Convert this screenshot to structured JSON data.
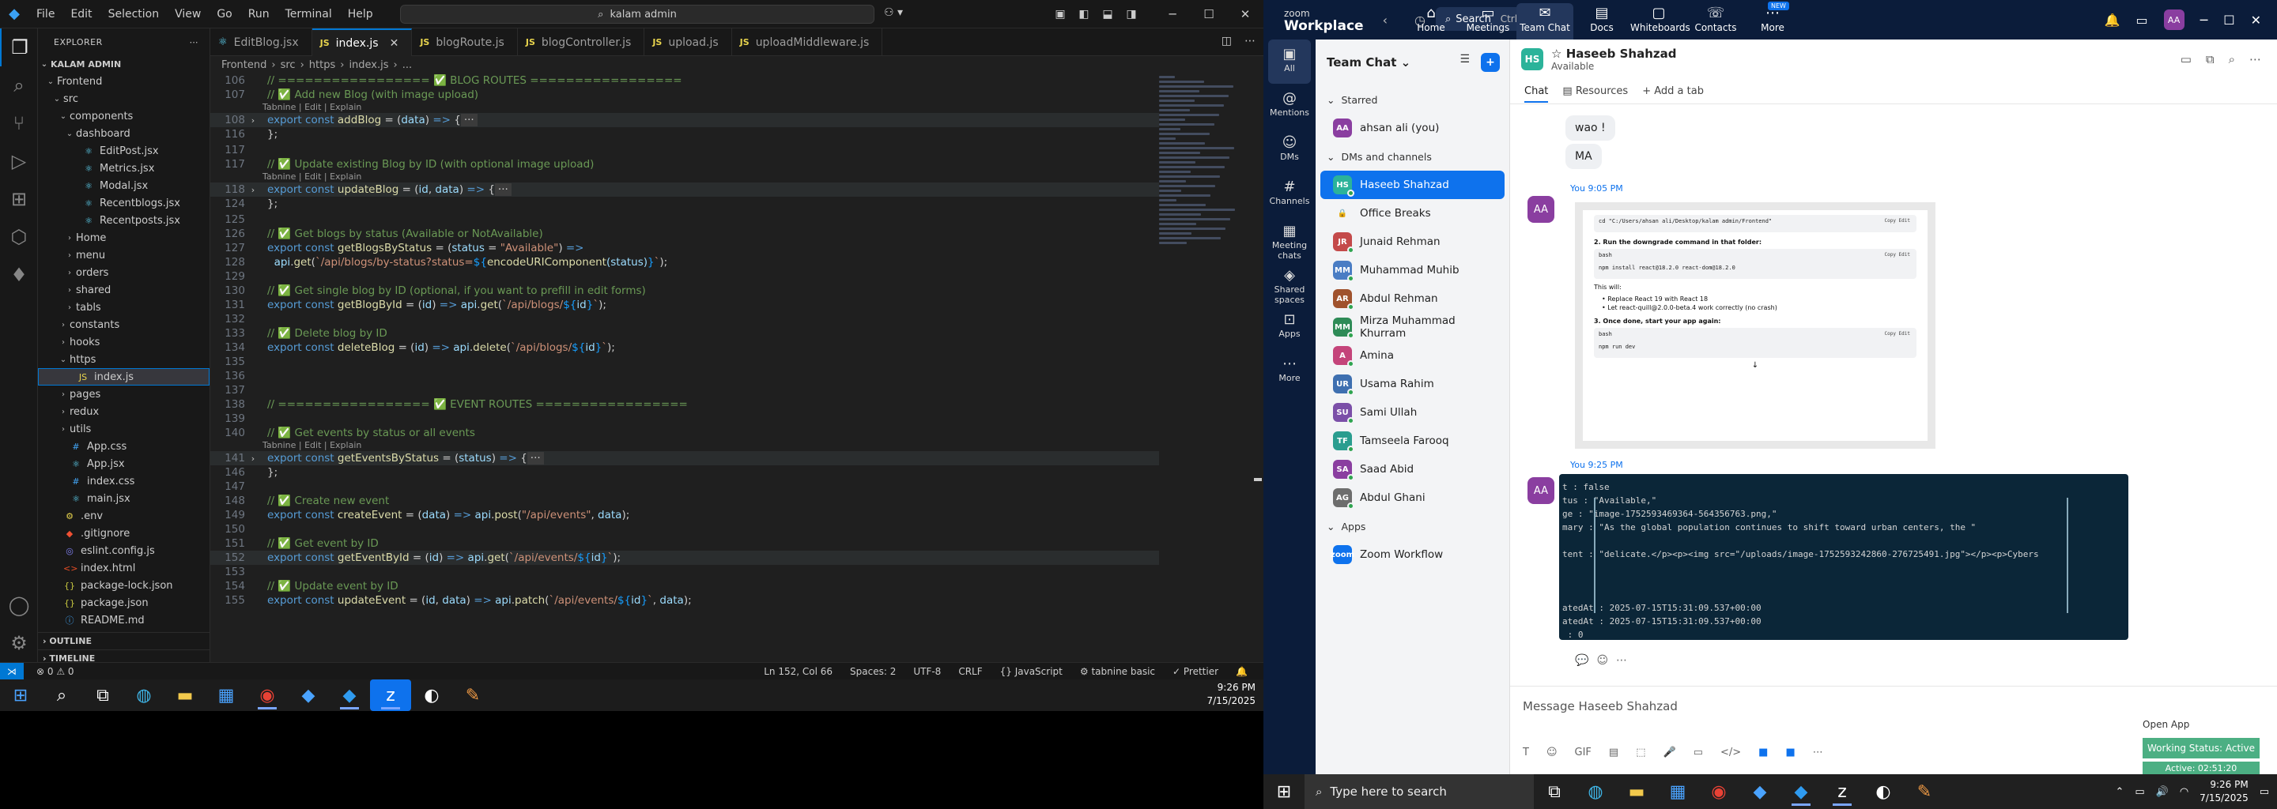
{
  "vscode": {
    "menu": [
      "File",
      "Edit",
      "Selection",
      "View",
      "Go",
      "Run",
      "Terminal",
      "Help"
    ],
    "command_center": "kalam admin",
    "explorer_title": "EXPLORER",
    "root": "KALAM ADMIN",
    "tree": [
      {
        "label": "Frontend",
        "depth": 1,
        "type": "folder",
        "open": true
      },
      {
        "label": "src",
        "depth": 2,
        "type": "folder",
        "open": true
      },
      {
        "label": "components",
        "depth": 3,
        "type": "folder",
        "open": true
      },
      {
        "label": "dashboard",
        "depth": 4,
        "type": "folder",
        "open": true
      },
      {
        "label": "EditPost.jsx",
        "depth": 5,
        "type": "jsx"
      },
      {
        "label": "Metrics.jsx",
        "depth": 5,
        "type": "jsx"
      },
      {
        "label": "Modal.jsx",
        "depth": 5,
        "type": "jsx"
      },
      {
        "label": "Recentblogs.jsx",
        "depth": 5,
        "type": "jsx"
      },
      {
        "label": "Recentposts.jsx",
        "depth": 5,
        "type": "jsx"
      },
      {
        "label": "Home",
        "depth": 4,
        "type": "folder"
      },
      {
        "label": "menu",
        "depth": 4,
        "type": "folder"
      },
      {
        "label": "orders",
        "depth": 4,
        "type": "folder"
      },
      {
        "label": "shared",
        "depth": 4,
        "type": "folder"
      },
      {
        "label": "tabls",
        "depth": 4,
        "type": "folder"
      },
      {
        "label": "constants",
        "depth": 3,
        "type": "folder"
      },
      {
        "label": "hooks",
        "depth": 3,
        "type": "folder"
      },
      {
        "label": "https",
        "depth": 3,
        "type": "folder",
        "open": true
      },
      {
        "label": "index.js",
        "depth": 4,
        "type": "js",
        "selected": true
      },
      {
        "label": "pages",
        "depth": 3,
        "type": "folder"
      },
      {
        "label": "redux",
        "depth": 3,
        "type": "folder"
      },
      {
        "label": "utils",
        "depth": 3,
        "type": "folder"
      },
      {
        "label": "App.css",
        "depth": 3,
        "type": "css"
      },
      {
        "label": "App.jsx",
        "depth": 3,
        "type": "jsx"
      },
      {
        "label": "index.css",
        "depth": 3,
        "type": "css"
      },
      {
        "label": "main.jsx",
        "depth": 3,
        "type": "jsx"
      },
      {
        "label": ".env",
        "depth": 2,
        "type": "env"
      },
      {
        "label": ".gitignore",
        "depth": 2,
        "type": "git"
      },
      {
        "label": "eslint.config.js",
        "depth": 2,
        "type": "eslint"
      },
      {
        "label": "index.html",
        "depth": 2,
        "type": "html"
      },
      {
        "label": "package-lock.json",
        "depth": 2,
        "type": "json"
      },
      {
        "label": "package.json",
        "depth": 2,
        "type": "json"
      },
      {
        "label": "README.md",
        "depth": 2,
        "type": "md"
      }
    ],
    "outline_label": "OUTLINE",
    "timeline_label": "TIMELINE",
    "tabs": [
      {
        "label": "EditBlog.jsx",
        "icon": "react"
      },
      {
        "label": "index.js",
        "icon": "js",
        "active": true
      },
      {
        "label": "blogRoute.js",
        "icon": "js"
      },
      {
        "label": "blogController.js",
        "icon": "js"
      },
      {
        "label": "upload.js",
        "icon": "js"
      },
      {
        "label": "uploadMiddleware.js",
        "icon": "js"
      }
    ],
    "breadcrumb": [
      "Frontend",
      "src",
      "https",
      "index.js",
      "..."
    ],
    "lens": "Tabnine | Edit | Explain",
    "status": {
      "errors": "⊗ 0 ⚠ 0",
      "position": "Ln 152, Col 66",
      "spaces": "Spaces: 2",
      "encoding": "UTF-8",
      "eol": "CRLF",
      "language": "{} JavaScript",
      "tabnine": "⚙ tabnine basic",
      "prettier": "✓ Prettier"
    }
  },
  "code_lines": [
    {
      "n": "106",
      "t": "// ================= ✅ BLOG ROUTES =================",
      "cls": "c"
    },
    {
      "n": "107",
      "t": "// ✅ Add new Blog (with image upload)",
      "cls": "c"
    },
    {
      "n": "108",
      "t": "export const addBlog = (data) => {···",
      "fold": true,
      "hl": true
    },
    {
      "n": "116",
      "t": "};"
    },
    {
      "n": "117",
      "t": ""
    },
    {
      "n": "117",
      "t": "// ✅ Update existing Blog by ID (with optional image upload)",
      "cls": "c"
    },
    {
      "n": "118",
      "t": "export const updateBlog = (id, data) => {···",
      "fold": true,
      "hl": true
    },
    {
      "n": "124",
      "t": "};"
    },
    {
      "n": "125",
      "t": ""
    },
    {
      "n": "126",
      "t": "// ✅ Get blogs by status (Available or NotAvailable)",
      "cls": "c"
    },
    {
      "n": "127",
      "t": "export const getBlogsByStatus = (status = \"Available\") =>"
    },
    {
      "n": "128",
      "t": "  api.get(`/api/blogs/by-status?status=${encodeURIComponent(status)}`);"
    },
    {
      "n": "129",
      "t": ""
    },
    {
      "n": "130",
      "t": "// ✅ Get single blog by ID (optional, if you want to prefill in edit forms)",
      "cls": "c"
    },
    {
      "n": "131",
      "t": "export const getBlogById = (id) => api.get(`/api/blogs/${id}`);"
    },
    {
      "n": "132",
      "t": ""
    },
    {
      "n": "133",
      "t": "// ✅ Delete blog by ID",
      "cls": "c"
    },
    {
      "n": "134",
      "t": "export const deleteBlog = (id) => api.delete(`/api/blogs/${id}`);"
    },
    {
      "n": "135",
      "t": ""
    },
    {
      "n": "136",
      "t": ""
    },
    {
      "n": "137",
      "t": ""
    },
    {
      "n": "138",
      "t": "// ================= ✅ EVENT ROUTES =================",
      "cls": "c"
    },
    {
      "n": "139",
      "t": ""
    },
    {
      "n": "140",
      "t": "// ✅ Get events by status or all events",
      "cls": "c"
    },
    {
      "n": "141",
      "t": "export const getEventsByStatus = (status) => {···",
      "fold": true,
      "hl": true
    },
    {
      "n": "146",
      "t": "};"
    },
    {
      "n": "147",
      "t": ""
    },
    {
      "n": "148",
      "t": "// ✅ Create new event",
      "cls": "c"
    },
    {
      "n": "149",
      "t": "export const createEvent = (data) => api.post(\"/api/events\", data);"
    },
    {
      "n": "150",
      "t": ""
    },
    {
      "n": "151",
      "t": "// ✅ Get event by ID",
      "cls": "c"
    },
    {
      "n": "152",
      "t": "export const getEventById = (id) => api.get(`/api/events/${id}`);",
      "hl": true
    },
    {
      "n": "153",
      "t": ""
    },
    {
      "n": "154",
      "t": "// ✅ Update event by ID",
      "cls": "c"
    },
    {
      "n": "155",
      "t": "export const updateEvent = (id, data) => api.patch(`/api/events/${id}`, data);"
    }
  ],
  "taskbar_left": {
    "time": "9:26 PM",
    "date": "7/15/2025"
  },
  "zoom": {
    "brand_top": "zoom",
    "brand": "Workplace",
    "search": "Search",
    "search_kb": "Ctrl+F",
    "tabs": [
      {
        "label": "Home",
        "icon": "⌂"
      },
      {
        "label": "Meetings",
        "icon": "▭"
      },
      {
        "label": "Team Chat",
        "icon": "✉",
        "active": true
      },
      {
        "label": "Docs",
        "icon": "▤"
      },
      {
        "label": "Whiteboards",
        "icon": "▢"
      },
      {
        "label": "Contacts",
        "icon": "☏"
      },
      {
        "label": "More",
        "icon": "⋯",
        "badge": "NEW"
      }
    ],
    "avatar": "AA",
    "rail": [
      {
        "label": "All",
        "icon": "▣",
        "active": true
      },
      {
        "label": "Mentions",
        "icon": "@"
      },
      {
        "label": "DMs",
        "icon": "☺"
      },
      {
        "label": "Channels",
        "icon": "#"
      },
      {
        "label": "Meeting chats",
        "icon": "▦"
      },
      {
        "label": "Shared spaces",
        "icon": "◈"
      },
      {
        "label": "Apps",
        "icon": "⊡"
      },
      {
        "label": "More",
        "icon": "⋯"
      }
    ],
    "list_title": "Team Chat",
    "sections": {
      "starred": "Starred",
      "dms": "DMs and channels",
      "apps": "Apps"
    },
    "starred": [
      {
        "label": "ahsan ali (you)",
        "init": "AA",
        "color": "#8a3ea0"
      }
    ],
    "contacts": [
      {
        "label": "Haseeb Shahzad",
        "init": "HS",
        "color": "#2bb39a",
        "active": true
      },
      {
        "label": "Office Breaks",
        "init": "🔒",
        "color": "#f3f4f6"
      },
      {
        "label": "Junaid Rehman",
        "init": "JR",
        "color": "#c44a4a"
      },
      {
        "label": "Muhammad Muhib",
        "init": "MM",
        "color": "#4a7dc4"
      },
      {
        "label": "Abdul Rehman",
        "init": "AR",
        "color": "#a0522d"
      },
      {
        "label": "Mirza Muhammad Khurram",
        "init": "MM",
        "color": "#2e8b57"
      },
      {
        "label": "Amina",
        "init": "A",
        "color": "#c4447a"
      },
      {
        "label": "Usama Rahim",
        "init": "UR",
        "color": "#3e6fb0"
      },
      {
        "label": "Sami Ullah",
        "init": "SU",
        "color": "#7b4fa8"
      },
      {
        "label": "Tamseela Farooq",
        "init": "TF",
        "color": "#2a9d8f"
      },
      {
        "label": "Saad Abid",
        "init": "SA",
        "color": "#8a3ea0"
      },
      {
        "label": "Abdul Ghani",
        "init": "AG",
        "color": "#6d6d6d"
      }
    ],
    "apps": [
      {
        "label": "Zoom Workflow",
        "init": "zoom",
        "color": "#0e72ed"
      }
    ],
    "chat": {
      "name": "Haseeb Shahzad",
      "init": "HS",
      "status": "Available",
      "subtabs": [
        "Chat",
        "Resources",
        "Add a tab"
      ],
      "msg1": "wao !",
      "msg2": "MA",
      "stamp1": "You 9:05 PM",
      "stamp2": "You 9:25 PM",
      "my_init": "AA",
      "img1": {
        "path": "cd \"C:/Users/ahsan ali/Desktop/kalam admin/Frontend\"",
        "step2": "2.  Run the downgrade command in that folder:",
        "cmd": "npm install react@18.2.0 react-dom@18.2.0",
        "will": "This will:",
        "b1": "Replace React 19 with React 18",
        "b2": "Let react-quill@2.0.0-beta.4 work correctly (no crash)",
        "step3": "3.  Once done, start your app again:",
        "run": "npm run dev",
        "lang": "bash",
        "copy": "Copy  Edit"
      },
      "img2": [
        "t : false",
        "tus : \"Available,\"",
        "ge : \"image-1752593469364-564356763.png,\"",
        "mary : \"As the global population continues to shift toward urban centers, the \"",
        "",
        "tent : \"delicate.</p><p><img src=\"/uploads/image-1752593242860-276725491.jpg\"></p><p>Cybers",
        "",
        "",
        "",
        "atedAt : 2025-07-15T15:31:09.537+00:00",
        "atedAt : 2025-07-15T15:31:09.537+00:00",
        " : 0"
      ],
      "compose_placeholder": "Message Haseeb Shahzad",
      "open_app": "Open App",
      "working_status": "Working Status: Active",
      "active_timer": "Active: 02:51:20"
    }
  },
  "taskbar_right": {
    "search": "Type here to search",
    "time": "9:26 PM",
    "date": "7/15/2025"
  },
  "colors": {
    "vscode_accent": "#0078d4",
    "zoom_blue": "#0e72ed",
    "zoom_nav": "#0b1c3a",
    "working_status": "#4caf83"
  }
}
